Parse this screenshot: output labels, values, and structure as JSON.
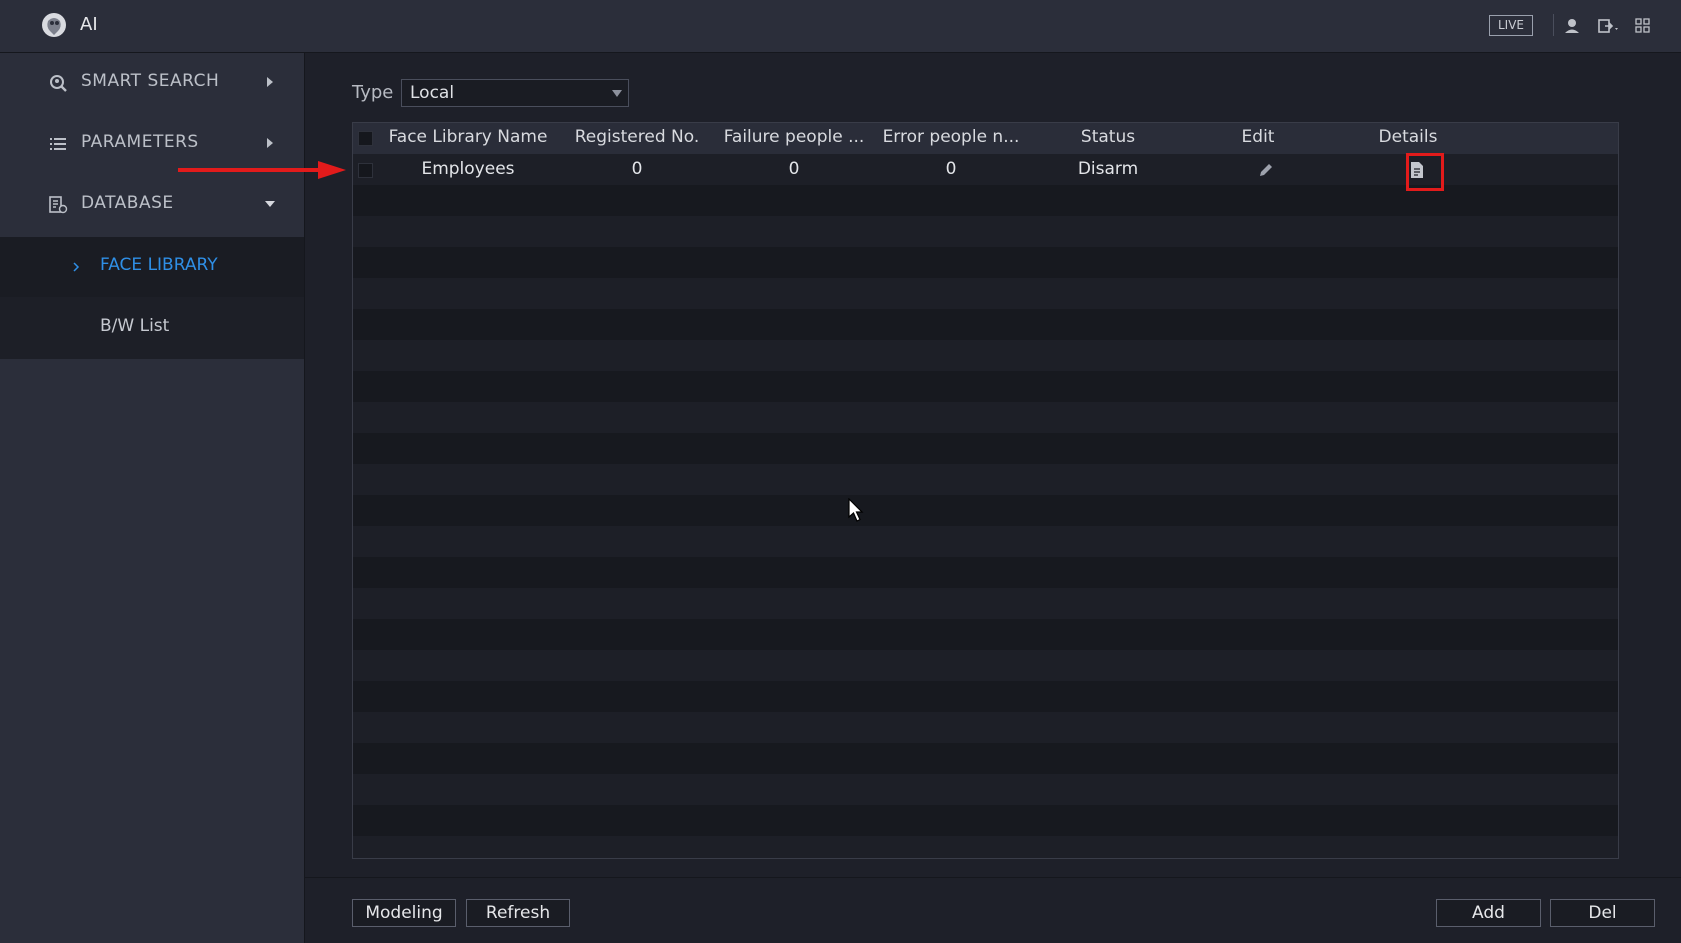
{
  "header": {
    "title": "AI",
    "live_label": "LIVE",
    "icons": [
      "app-logo-icon",
      "user-icon",
      "logout-icon",
      "menu-grid-icon"
    ]
  },
  "sidebar": {
    "items": [
      {
        "label": "SMART SEARCH",
        "icon": "smart-search-icon"
      },
      {
        "label": "PARAMETERS",
        "icon": "list-icon"
      },
      {
        "label": "DATABASE",
        "icon": "database-icon"
      }
    ],
    "submenu": [
      {
        "label": "FACE LIBRARY",
        "active": true
      },
      {
        "label": "B/W List",
        "active": false
      }
    ]
  },
  "filter": {
    "type_label": "Type",
    "type_value": "Local"
  },
  "table": {
    "columns": [
      "Face Library Name",
      "Registered No.",
      "Failure people ...",
      "Error people n...",
      "Status",
      "Edit",
      "Details"
    ],
    "rows": [
      {
        "name": "Employees",
        "registered": "0",
        "failure": "0",
        "error": "0",
        "status": "Disarm"
      }
    ]
  },
  "footer": {
    "modeling_label": "Modeling",
    "refresh_label": "Refresh",
    "add_label": "Add",
    "del_label": "Del"
  },
  "colors": {
    "accent": "#2f8fe6",
    "annotation": "#e21b1b",
    "background": "#1e2029",
    "panel": "#2b2e3a"
  }
}
